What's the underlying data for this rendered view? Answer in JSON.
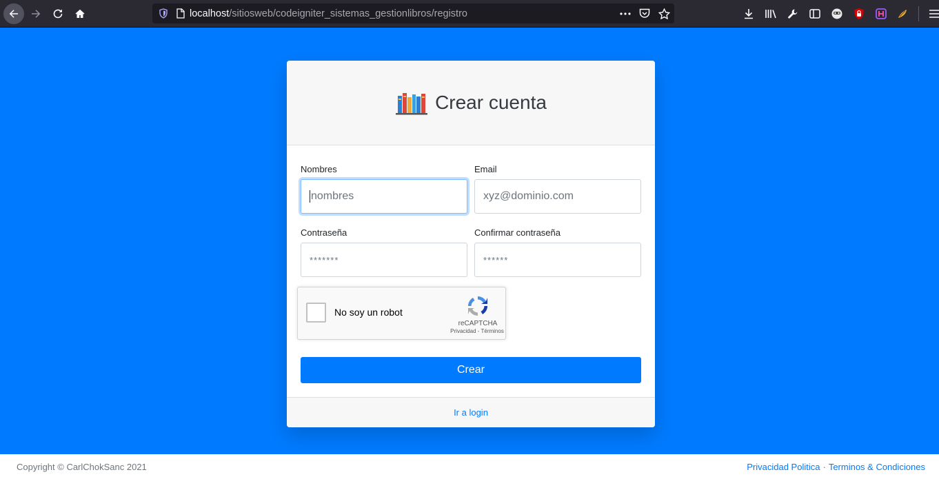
{
  "browser": {
    "url_host": "localhost",
    "url_path": "/sitiosweb/codeigniter_sistemas_gestionlibros/registro",
    "icons": [
      "back-icon",
      "forward-icon",
      "reload-icon",
      "home-icon",
      "tracking-shield-icon",
      "page-info-icon",
      "more-actions-icon",
      "pocket-icon",
      "bookmark-star-icon",
      "download-icon",
      "library-icon",
      "wrench-icon",
      "sidebar-icon",
      "extension-icon",
      "ublock-icon",
      "extension-icon",
      "extension-icon",
      "menu-icon"
    ]
  },
  "card": {
    "title": "Crear cuenta",
    "fields": {
      "nombres": {
        "label": "Nombres",
        "placeholder": "nombres"
      },
      "email": {
        "label": "Email",
        "placeholder": "xyz@dominio.com"
      },
      "password": {
        "label": "Contraseña",
        "placeholder": "*******"
      },
      "confirm": {
        "label": "Confirmar contraseña",
        "placeholder": "******"
      }
    },
    "recaptcha": {
      "label": "No soy un robot",
      "brand": "reCAPTCHA",
      "terms": "Privacidad - Términos"
    },
    "submit_label": "Crear",
    "login_link": "Ir a login"
  },
  "footer": {
    "copyright": "Copyright © CarlChokSanc 2021",
    "privacy_link": "Privacidad Politica",
    "separator": "·",
    "terms_link": "Terminos & Condiciones"
  },
  "colors": {
    "page_background": "#007bff",
    "primary": "#007bff",
    "browser_chrome": "#2b2a33"
  }
}
